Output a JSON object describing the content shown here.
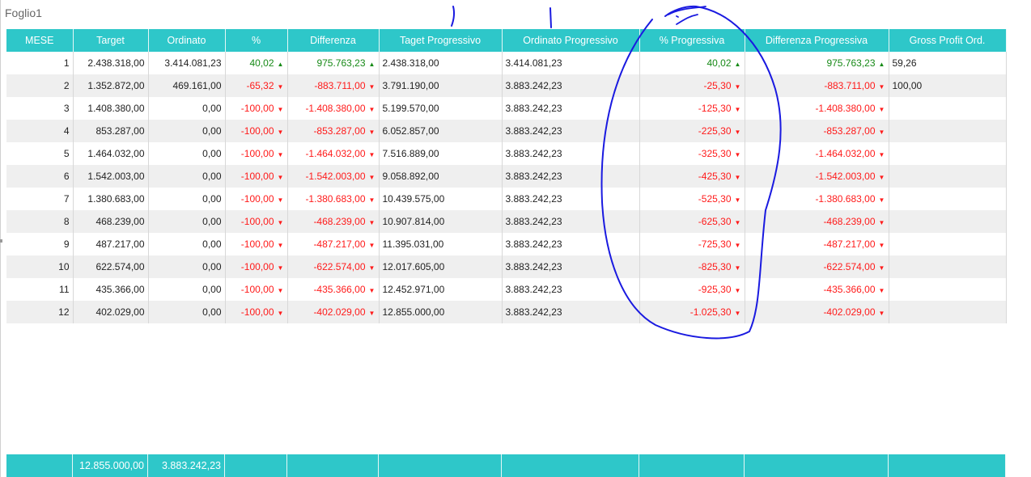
{
  "sheet": {
    "name": "Foglio1"
  },
  "columns": [
    "MESE",
    "Target",
    "Ordinato",
    "%",
    "Differenza",
    "Taget Progressivo",
    "Ordinato Progressivo",
    "% Progressiva",
    "Differenza Progressiva",
    "Gross Profit Ord."
  ],
  "rows": [
    {
      "mese": "1",
      "target": "2.438.318,00",
      "ordinato": "3.414.081,23",
      "pct": "40,02",
      "pct_dir": "up",
      "diff": "975.763,23",
      "diff_dir": "up",
      "target_prog": "2.438.318,00",
      "ord_prog": "3.414.081,23",
      "pct_prog": "40,02",
      "pct_prog_dir": "up",
      "diff_prog": "975.763,23",
      "diff_prog_dir": "up",
      "gross": "59,26"
    },
    {
      "mese": "2",
      "target": "1.352.872,00",
      "ordinato": "469.161,00",
      "pct": "-65,32",
      "pct_dir": "down",
      "diff": "-883.711,00",
      "diff_dir": "down",
      "target_prog": "3.791.190,00",
      "ord_prog": "3.883.242,23",
      "pct_prog": "-25,30",
      "pct_prog_dir": "down",
      "diff_prog": "-883.711,00",
      "diff_prog_dir": "down",
      "gross": "100,00"
    },
    {
      "mese": "3",
      "target": "1.408.380,00",
      "ordinato": "0,00",
      "pct": "-100,00",
      "pct_dir": "down",
      "diff": "-1.408.380,00",
      "diff_dir": "down",
      "target_prog": "5.199.570,00",
      "ord_prog": "3.883.242,23",
      "pct_prog": "-125,30",
      "pct_prog_dir": "down",
      "diff_prog": "-1.408.380,00",
      "diff_prog_dir": "down",
      "gross": ""
    },
    {
      "mese": "4",
      "target": "853.287,00",
      "ordinato": "0,00",
      "pct": "-100,00",
      "pct_dir": "down",
      "diff": "-853.287,00",
      "diff_dir": "down",
      "target_prog": "6.052.857,00",
      "ord_prog": "3.883.242,23",
      "pct_prog": "-225,30",
      "pct_prog_dir": "down",
      "diff_prog": "-853.287,00",
      "diff_prog_dir": "down",
      "gross": ""
    },
    {
      "mese": "5",
      "target": "1.464.032,00",
      "ordinato": "0,00",
      "pct": "-100,00",
      "pct_dir": "down",
      "diff": "-1.464.032,00",
      "diff_dir": "down",
      "target_prog": "7.516.889,00",
      "ord_prog": "3.883.242,23",
      "pct_prog": "-325,30",
      "pct_prog_dir": "down",
      "diff_prog": "-1.464.032,00",
      "diff_prog_dir": "down",
      "gross": ""
    },
    {
      "mese": "6",
      "target": "1.542.003,00",
      "ordinato": "0,00",
      "pct": "-100,00",
      "pct_dir": "down",
      "diff": "-1.542.003,00",
      "diff_dir": "down",
      "target_prog": "9.058.892,00",
      "ord_prog": "3.883.242,23",
      "pct_prog": "-425,30",
      "pct_prog_dir": "down",
      "diff_prog": "-1.542.003,00",
      "diff_prog_dir": "down",
      "gross": ""
    },
    {
      "mese": "7",
      "target": "1.380.683,00",
      "ordinato": "0,00",
      "pct": "-100,00",
      "pct_dir": "down",
      "diff": "-1.380.683,00",
      "diff_dir": "down",
      "target_prog": "10.439.575,00",
      "ord_prog": "3.883.242,23",
      "pct_prog": "-525,30",
      "pct_prog_dir": "down",
      "diff_prog": "-1.380.683,00",
      "diff_prog_dir": "down",
      "gross": ""
    },
    {
      "mese": "8",
      "target": "468.239,00",
      "ordinato": "0,00",
      "pct": "-100,00",
      "pct_dir": "down",
      "diff": "-468.239,00",
      "diff_dir": "down",
      "target_prog": "10.907.814,00",
      "ord_prog": "3.883.242,23",
      "pct_prog": "-625,30",
      "pct_prog_dir": "down",
      "diff_prog": "-468.239,00",
      "diff_prog_dir": "down",
      "gross": ""
    },
    {
      "mese": "9",
      "target": "487.217,00",
      "ordinato": "0,00",
      "pct": "-100,00",
      "pct_dir": "down",
      "diff": "-487.217,00",
      "diff_dir": "down",
      "target_prog": "11.395.031,00",
      "ord_prog": "3.883.242,23",
      "pct_prog": "-725,30",
      "pct_prog_dir": "down",
      "diff_prog": "-487.217,00",
      "diff_prog_dir": "down",
      "gross": ""
    },
    {
      "mese": "10",
      "target": "622.574,00",
      "ordinato": "0,00",
      "pct": "-100,00",
      "pct_dir": "down",
      "diff": "-622.574,00",
      "diff_dir": "down",
      "target_prog": "12.017.605,00",
      "ord_prog": "3.883.242,23",
      "pct_prog": "-825,30",
      "pct_prog_dir": "down",
      "diff_prog": "-622.574,00",
      "diff_prog_dir": "down",
      "gross": ""
    },
    {
      "mese": "11",
      "target": "435.366,00",
      "ordinato": "0,00",
      "pct": "-100,00",
      "pct_dir": "down",
      "diff": "-435.366,00",
      "diff_dir": "down",
      "target_prog": "12.452.971,00",
      "ord_prog": "3.883.242,23",
      "pct_prog": "-925,30",
      "pct_prog_dir": "down",
      "diff_prog": "-435.366,00",
      "diff_prog_dir": "down",
      "gross": ""
    },
    {
      "mese": "12",
      "target": "402.029,00",
      "ordinato": "0,00",
      "pct": "-100,00",
      "pct_dir": "down",
      "diff": "-402.029,00",
      "diff_dir": "down",
      "target_prog": "12.855.000,00",
      "ord_prog": "3.883.242,23",
      "pct_prog": "-1.025,30",
      "pct_prog_dir": "down",
      "diff_prog": "-402.029,00",
      "diff_prog_dir": "down",
      "gross": ""
    }
  ],
  "totals": {
    "target": "12.855.000,00",
    "ordinato": "3.883.242,23"
  },
  "colors": {
    "header": "#2ec7c9",
    "positive": "#178a17",
    "negative": "#ff1a1a",
    "annotation": "#1a1ae0"
  },
  "icons": {
    "up": "triangle-up-icon",
    "down": "triangle-down-icon"
  }
}
